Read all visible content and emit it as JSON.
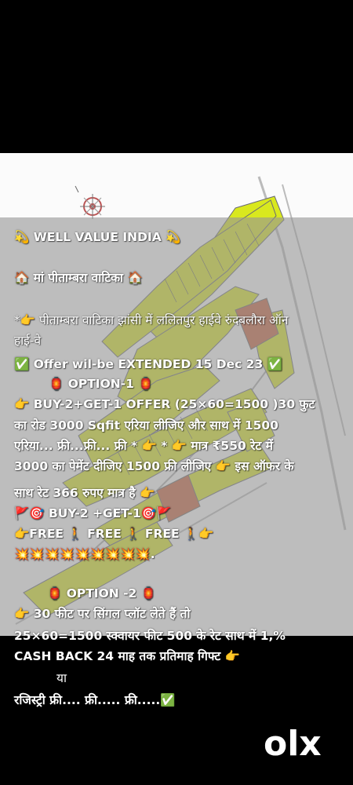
{
  "post": {
    "lines": [
      "💫 WELL VALUE INDIA 💫",
      "🏠 मां पीताम्बरा वाटिका 🏠",
      "*👉  पीताम्बरा वाटिका झांसी में ललितपुर हाईवे रुंदबलौरा ऑन",
      "हाई-वे",
      "✅ Offer wil-be EXTENDED 15 Dec 23 ✅",
      "🏮 OPTION-1 🏮",
      "👉 BUY-2+GET-1 OFFER (25×60=1500 )30 फुट",
      "का रोड 3000 Sqfit एरिया लीजिए और साथ में  1500",
      "एरिया... फ्री...फ्री... फ्री * 👉 * 👉 मात्र ₹550 रेट में",
      "3000 का पेमेंट दीजिए 1500 फ्री लीजिए 👉 इस ऑफर के",
      "साथ रेट 366 रुपए मात्र है 👉",
      "🚩🎯 BUY-2 +GET-1🎯🚩",
      "👉FREE 🚶 FREE 🚶 FREE 🚶👉",
      "💥💥💥💥💥💥💥💥💥.",
      "🏮 OPTION -2 🏮",
      "👉 30 फीट पर सिंगल प्लॉट लेते हैं तो",
      "25×60=1500 स्क्वायर फीट 500 के रेट साथ में 1,%",
      "CASH BACK 24 माह तक प्रतिमाह गिफ्ट 👉",
      "या",
      "रजिस्ट्री फ्री.... फ्री..... फ्री.....✅"
    ]
  },
  "watermark": {
    "logo_text": "olx",
    "logo_icon": "olx-logo"
  },
  "map": {
    "plot_color": "#d9e81e",
    "building_color": "#c8603a",
    "icon": "compass-icon"
  }
}
